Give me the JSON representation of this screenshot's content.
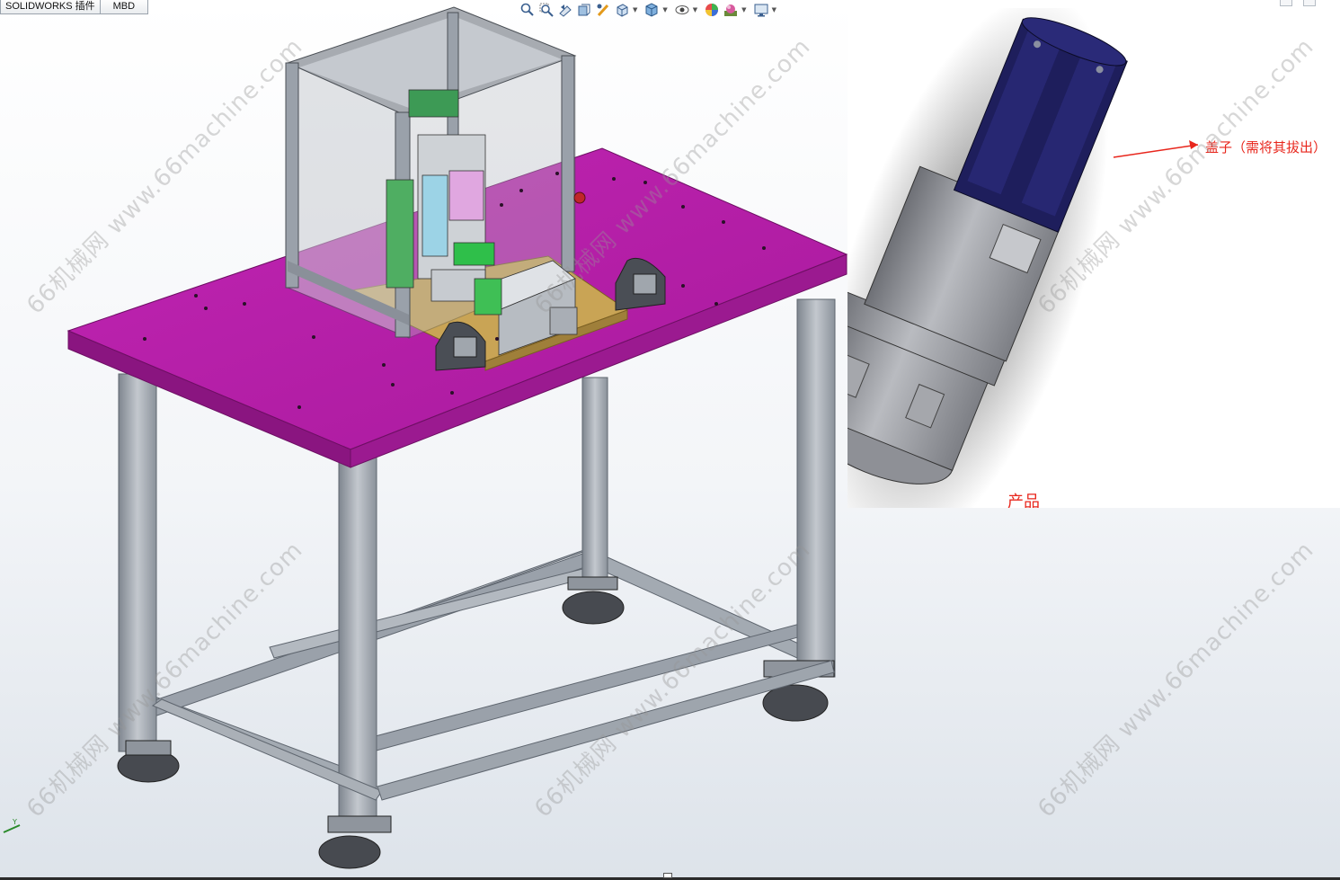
{
  "tabs": [
    {
      "label": "SOLIDWORKS 插件"
    },
    {
      "label": "MBD"
    }
  ],
  "toolbar": {
    "icons": [
      "zoom-to-fit-icon",
      "zoom-area-icon",
      "previous-view-icon",
      "section-view-icon",
      "dynamic-annotation-icon",
      "view-orientation-icon",
      "display-style-icon",
      "hide-show-items-icon",
      "edit-appearance-icon",
      "apply-scene-icon",
      "view-settings-icon"
    ]
  },
  "watermark": {
    "text": "66机械网 www.66machine.com"
  },
  "inset": {
    "callout_label": "盖子（需将其拔出）",
    "product_label": "产品",
    "callout_color": "#e8261c"
  },
  "colors": {
    "tabletop": "#b51fa8",
    "frame": "#9aa1aa",
    "plate": "#c9a455",
    "cap": "#1c1c5a",
    "body": "#9c9ea3"
  }
}
